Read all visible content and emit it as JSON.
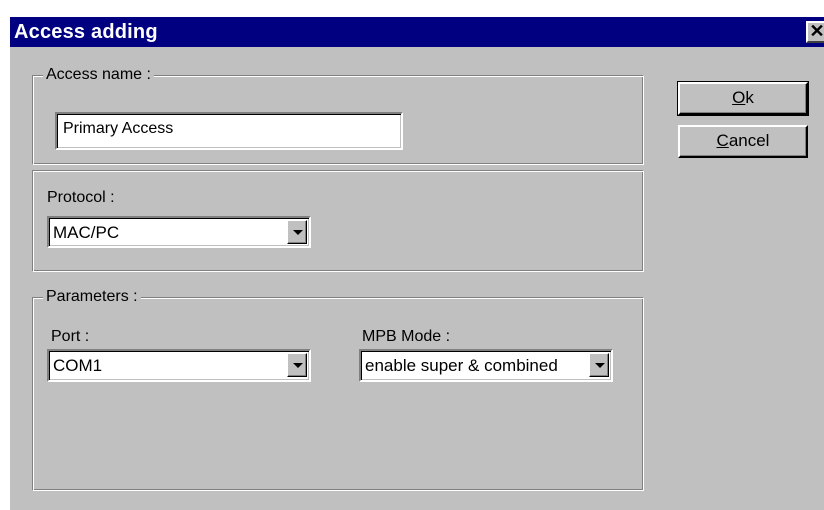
{
  "window": {
    "title": "Access adding",
    "close_glyph": "✕"
  },
  "access_name_group": {
    "legend": "Access name  :",
    "value": "Primary Access"
  },
  "protocol_group": {
    "label": "Protocol  :",
    "selected": "MAC/PC"
  },
  "parameters_group": {
    "legend": "Parameters :",
    "port_label": "Port :",
    "port_selected": "COM1",
    "mpb_label": "MPB Mode :",
    "mpb_selected": "enable super & combined"
  },
  "buttons": {
    "ok_mnemonic": "O",
    "ok_rest": "k",
    "cancel_mnemonic": "C",
    "cancel_rest": "ancel"
  },
  "colors": {
    "titlebar": "#000080",
    "face": "#c0c0c0"
  },
  "icons": {
    "close": "close-icon",
    "dropdown": "chevron-down-icon"
  }
}
